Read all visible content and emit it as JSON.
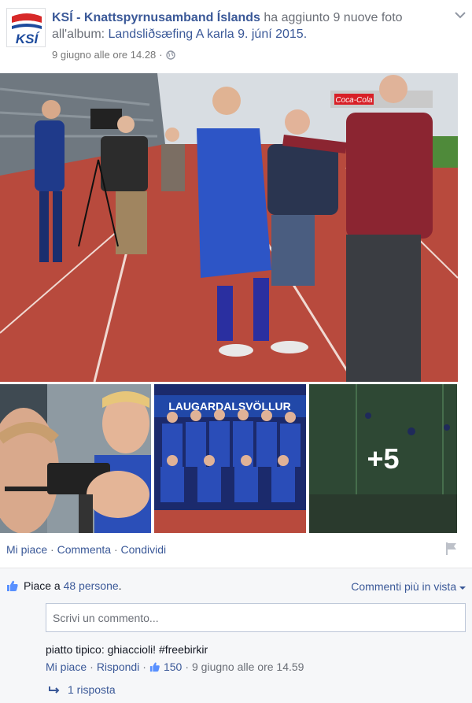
{
  "header": {
    "page_name": "KSÍ - Knattspyrnusamband Íslands",
    "action_text": " ha aggiunto 9 nuove foto all'album: ",
    "album_name": "Landsliðsæfing A karla 9. júní 2015.",
    "timestamp": "9 giugno alle ore 14.28",
    "meta_sep": "·",
    "avatar_logo_text": "KSÍ"
  },
  "photos": {
    "more_count": "+5",
    "banner_text": "LAUGARDALSVÖLLUR",
    "billboard_text": "Coca-Cola"
  },
  "actions": {
    "like": "Mi piace",
    "comment": "Commenta",
    "share": "Condividi",
    "sep": " · "
  },
  "ufi": {
    "likes_prefix": "Piace a ",
    "likes_count": "48 persone",
    "likes_suffix": ".",
    "top_comments": "Commenti più in vista",
    "comment_placeholder": "Scrivi un commento...",
    "comment_text": "piatto tipico: ghiaccioli! #freebirkir",
    "comment_like": "Mi piace",
    "comment_reply": "Rispondi",
    "comment_likes": "150",
    "comment_time": "9 giugno alle ore 14.59",
    "sep": " · ",
    "replies": "1 risposta"
  },
  "colors": {
    "link": "#3b5998",
    "muted": "#6b6f77",
    "track": "#b5453a"
  }
}
